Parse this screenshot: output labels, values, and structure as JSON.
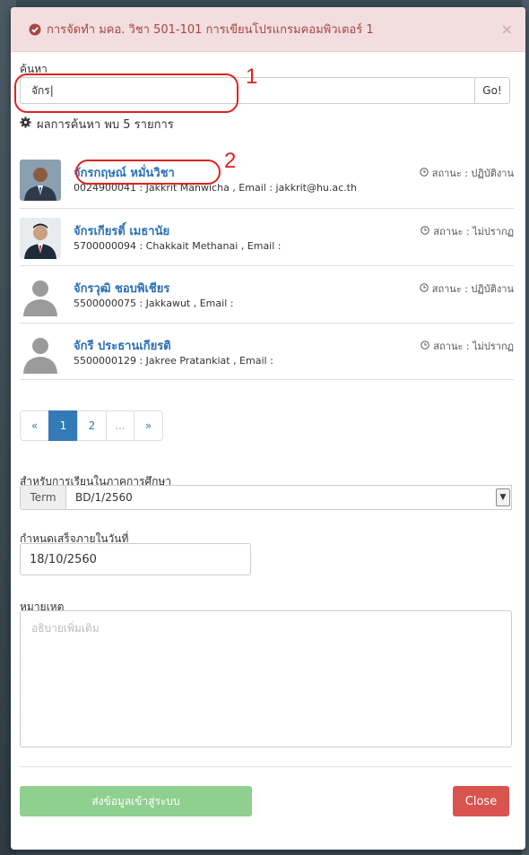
{
  "modal": {
    "title": "การจัดทำ มคอ. วิชา 501-101 การเขียนโปรแกรมคอมพิวเตอร์ 1",
    "close_glyph": "×"
  },
  "search": {
    "label": "ค้นหา",
    "value": "จักร|",
    "button_label": "Go!",
    "result_summary": "ผลการค้นหา พบ 5 รายการ"
  },
  "annotations": [
    "1",
    "2"
  ],
  "results": [
    {
      "name": "จักรกฤษณ์ หมั่นวิชา",
      "detail": "0024900041 : Jakkrit Manwicha , Email : jakkrit@hu.ac.th",
      "status": "สถานะ : ปฏิบัติงาน",
      "avatar": "photo"
    },
    {
      "name": "จักรเกียรติ์ เมธานัย",
      "detail": "5700000094 : Chakkait Methanai , Email :",
      "status": "สถานะ : ไม่ปรากฏ",
      "avatar": "photo"
    },
    {
      "name": "จักรวุฒิ ชอบพิเชียร",
      "detail": "5500000075 : Jakkawut , Email :",
      "status": "สถานะ : ปฏิบัติงาน",
      "avatar": "placeholder"
    },
    {
      "name": "จักรี ประธานเกียรติ",
      "detail": "5500000129 : Jakree Pratankiat , Email :",
      "status": "สถานะ : ไม่ปรากฏ",
      "avatar": "placeholder"
    }
  ],
  "pagination": {
    "prev": "«",
    "pages": [
      "1",
      "2",
      "..."
    ],
    "next": "»",
    "active": "1"
  },
  "semester": {
    "label": "สำหรับการเรียนในภาคการศึกษา",
    "addon": "Term",
    "selected": "BD/1/2560",
    "arrow": "▼"
  },
  "deadline": {
    "label": "กำหนดเสร็จภายในวันที่",
    "value": "18/10/2560"
  },
  "notes": {
    "label": "หมายเหตุ",
    "placeholder": "อธิบายเพิ่มเติม"
  },
  "footer": {
    "submit_label": "ส่งข้อมูลเข้าสู่ระบบ",
    "close_label": "Close"
  },
  "colors": {
    "header_bg": "#f2dede",
    "header_text": "#a94442",
    "link": "#2a6fb8",
    "primary": "#337ab7",
    "submit": "#8fcf8f",
    "danger": "#d9534f",
    "annotation": "#e0221f"
  },
  "icons": {
    "header": "check-circle-icon",
    "summary": "gear-icon",
    "status": "clock-icon"
  }
}
